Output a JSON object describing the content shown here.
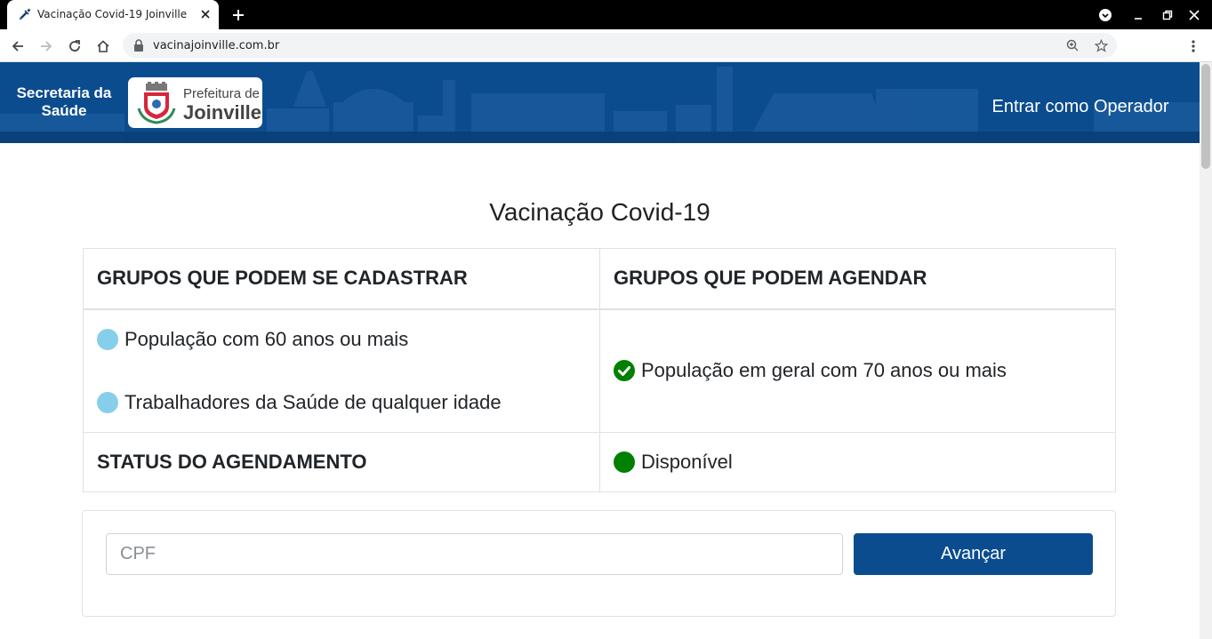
{
  "browser": {
    "tab_title": "Vacinação Covid-19 Joinville",
    "url": "vacinajoinville.com.br"
  },
  "header": {
    "secretaria_line1": "Secretaria da",
    "secretaria_line2": "Saúde",
    "logo_line1": "Prefeitura de",
    "logo_line2": "Joinville",
    "operator_link": "Entrar como Operador",
    "background_color": "#0b4c8f"
  },
  "main": {
    "title": "Vacinação Covid-19",
    "table": {
      "header_register": "GRUPOS QUE PODEM SE CADASTRAR",
      "header_schedule": "GRUPOS QUE PODEM AGENDAR",
      "register_groups": [
        {
          "label": "População com 60 anos ou mais",
          "icon": "blue-dot-icon",
          "color": "#87ceeb"
        },
        {
          "label": "Trabalhadores da Saúde de qualquer idade",
          "icon": "blue-dot-icon",
          "color": "#87ceeb"
        }
      ],
      "schedule_groups": [
        {
          "label": "População em geral com 70 anos ou mais",
          "icon": "check-circle-icon",
          "color": "#008000"
        }
      ],
      "status_label": "STATUS DO AGENDAMENTO",
      "status_value": "Disponível",
      "status_color": "#008000"
    },
    "form": {
      "cpf_placeholder": "CPF",
      "cpf_value": "",
      "submit_label": "Avançar",
      "button_color": "#0b4c8f"
    }
  }
}
